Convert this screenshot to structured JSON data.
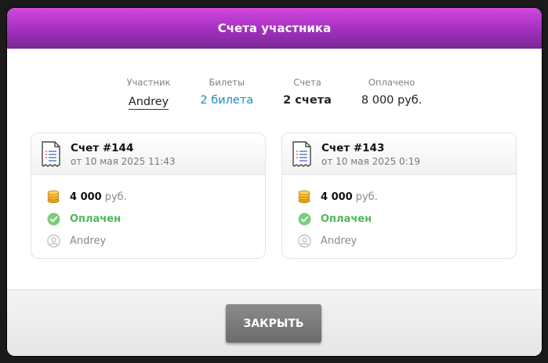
{
  "modal": {
    "title": "Счета участника"
  },
  "stats": [
    {
      "label": "Участник",
      "value": "Andrey"
    },
    {
      "label": "Билеты",
      "value": "2 билета"
    },
    {
      "label": "Счета",
      "value": "2 счета"
    },
    {
      "label": "Оплачено",
      "value": "8 000 руб."
    }
  ],
  "invoices": [
    {
      "title": "Счет #144",
      "date": "от 10 мая 2025 11:43",
      "amount": "4 000",
      "currency": "руб.",
      "status": "Оплачен",
      "user": "Andrey"
    },
    {
      "title": "Счет #143",
      "date": "от 10 мая 2025 0:19",
      "amount": "4 000",
      "currency": "руб.",
      "status": "Оплачен",
      "user": "Andrey"
    }
  ],
  "footer": {
    "close_label": "ЗАКРЫТЬ"
  },
  "icons": {
    "invoice": "invoice-document-icon",
    "amount": "coins-icon",
    "status": "check-circle-icon",
    "user": "user-circle-icon"
  },
  "colors": {
    "header_top": "#d048dc",
    "header_bottom": "#7c2a94",
    "link": "#1a8ac7",
    "paid": "#4cb85a",
    "button": "#7a7a7a"
  }
}
